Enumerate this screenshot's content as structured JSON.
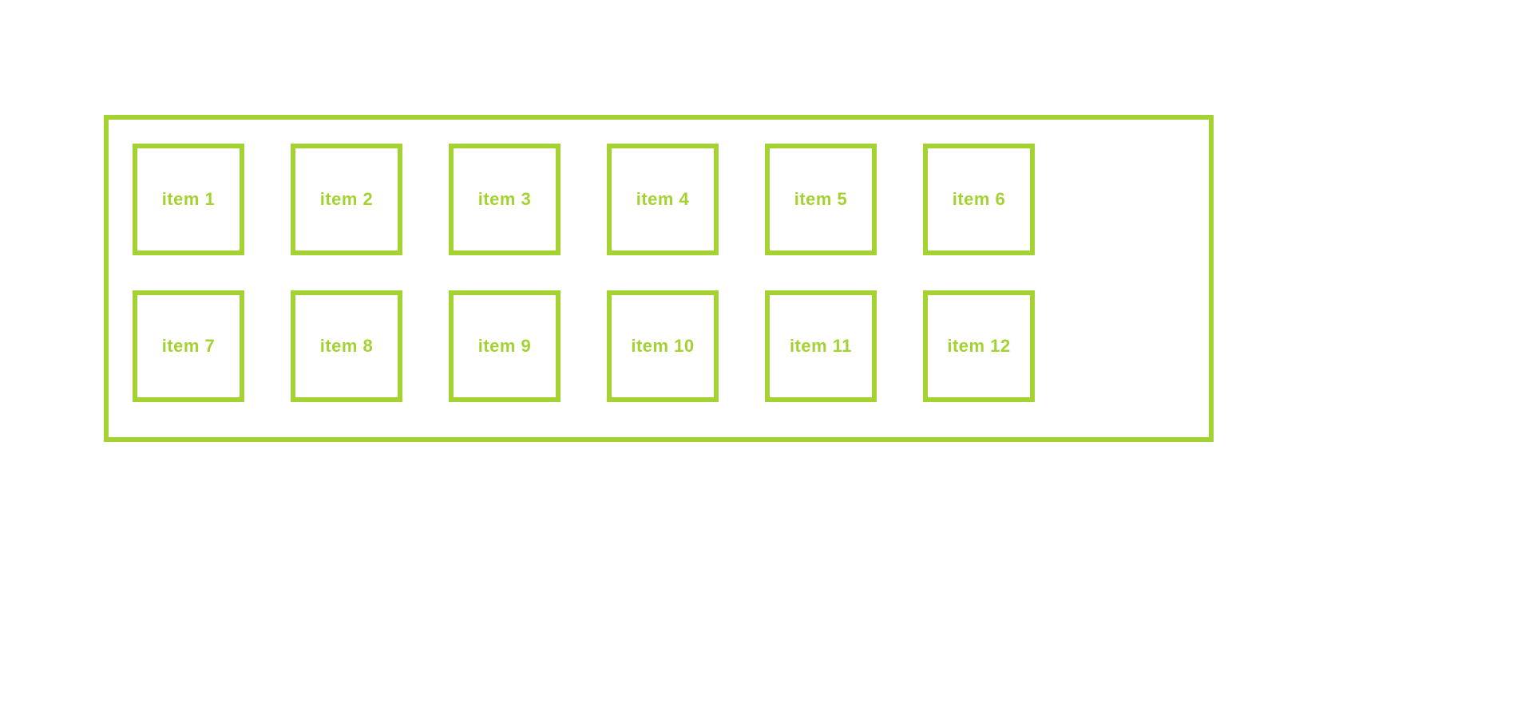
{
  "colors": {
    "accent": "#a4d233",
    "background": "#ffffff"
  },
  "grid": {
    "rows": 2,
    "cols": 6,
    "items": [
      {
        "label": "item 1"
      },
      {
        "label": "item 2"
      },
      {
        "label": "item 3"
      },
      {
        "label": "item 4"
      },
      {
        "label": "item 5"
      },
      {
        "label": "item 6"
      },
      {
        "label": "item 7"
      },
      {
        "label": "item 8"
      },
      {
        "label": "item 9"
      },
      {
        "label": "item 10"
      },
      {
        "label": "item 11"
      },
      {
        "label": "item 12"
      }
    ]
  }
}
